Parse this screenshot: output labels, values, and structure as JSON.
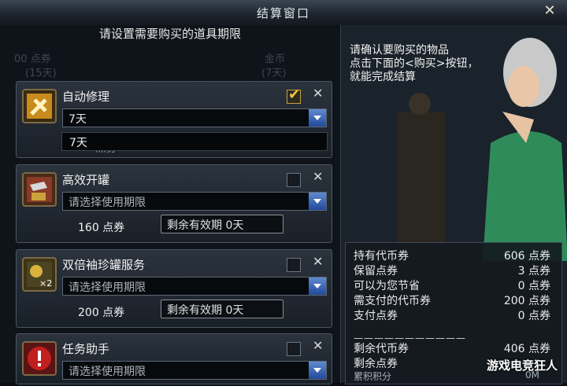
{
  "window": {
    "title": "结算窗口"
  },
  "left": {
    "bg_texts": [
      "金币",
      "(15天)",
      "(7天)",
      "00 点券"
    ],
    "instruction": "请设置需要购买的道具期限",
    "items": [
      {
        "name": "自动修理",
        "icon": "hammer-icon",
        "checked": true,
        "selected": "7天",
        "dropdown_option": "7天",
        "price_partial": "点券"
      },
      {
        "name": "高效开罐",
        "icon": "hammer-jar-icon",
        "checked": false,
        "selected": "请选择使用期限",
        "price": "160 点券",
        "remain": "剩余有效期 0天"
      },
      {
        "name": "双倍袖珍罐服务",
        "icon": "double-jar-icon",
        "checked": false,
        "selected": "请选择使用期限",
        "price": "200 点券",
        "remain": "剩余有效期 0天"
      },
      {
        "name": "任务助手",
        "icon": "task-alert-icon",
        "checked": false,
        "selected": "请选择使用期限"
      }
    ]
  },
  "right": {
    "message": [
      "请确认要购买的物品",
      "点击下面的<购买>按钮，",
      "就能完成结算"
    ],
    "stats": [
      {
        "label": "持有代币券",
        "value": "606 点券"
      },
      {
        "label": "保留点券",
        "value": "3 点券"
      },
      {
        "label": "可以为您节省",
        "value": "0 点券"
      },
      {
        "label": "需支付的代币券",
        "value": "200 点券"
      },
      {
        "label": "支付点券",
        "value": "0 点券"
      }
    ],
    "separator": "———————————",
    "stats2": [
      {
        "label": "剩余代币券",
        "value": "406 点券"
      },
      {
        "label": "剩余点券",
        "value": ""
      }
    ],
    "partial_label": "累积积分",
    "partial_value": "0M"
  },
  "watermark": "游戏电竞狂人"
}
